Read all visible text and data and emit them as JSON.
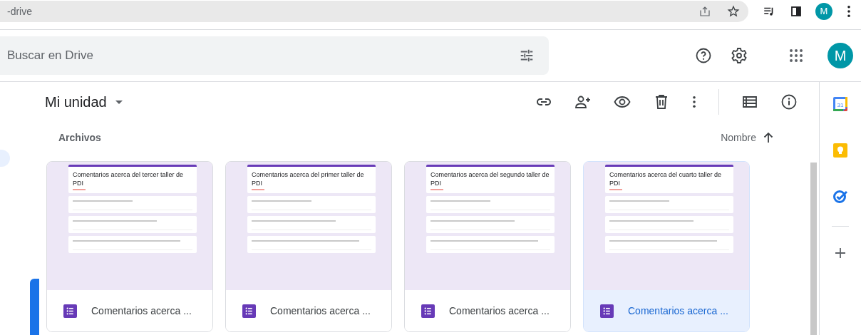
{
  "browser": {
    "url": "-drive",
    "profile_initial": "M"
  },
  "header": {
    "search": {
      "placeholder": "Buscar en Drive"
    },
    "avatar_initial": "M"
  },
  "location": {
    "title": "Mi unidad"
  },
  "section": {
    "title": "Archivos",
    "sort_label": "Nombre"
  },
  "files": [
    {
      "name": "Comentarios acerca ...",
      "selected": false,
      "preview": {
        "title": "Comentarios acerca del tercer taller de PDI"
      }
    },
    {
      "name": "Comentarios acerca ...",
      "selected": false,
      "preview": {
        "title": "Comentarios acerca del primer taller de PDI"
      }
    },
    {
      "name": "Comentarios acerca ...",
      "selected": false,
      "preview": {
        "title": "Comentarios acerca del segundo taller de PDI"
      }
    },
    {
      "name": "Comentarios acerca ...",
      "selected": true,
      "preview": {
        "title": "Comentarios acerca del cuarto taller de PDI"
      }
    }
  ],
  "side_panel": {
    "calendar_day": "31"
  }
}
